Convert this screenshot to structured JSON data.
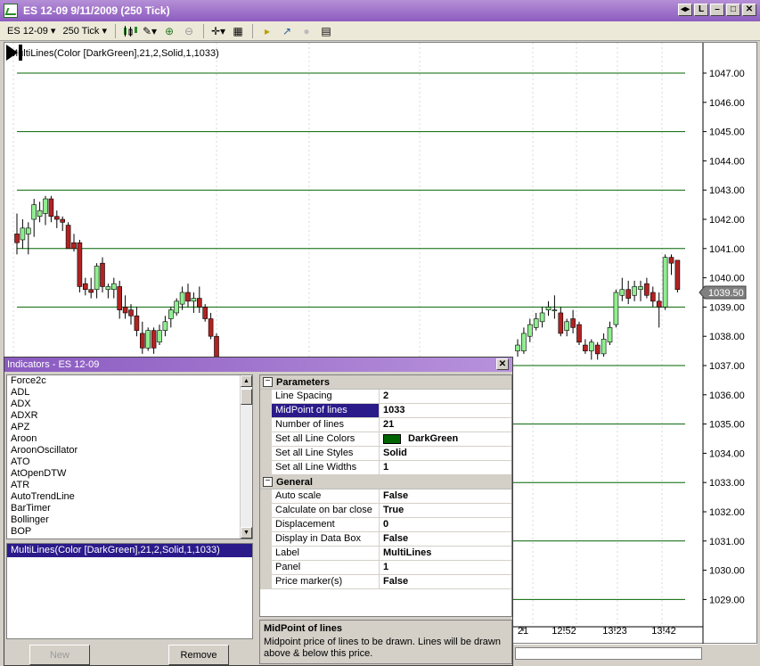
{
  "window": {
    "title": "ES 12-09  9/11/2009 (250 Tick)"
  },
  "toolbar": {
    "instrument": "ES 12-09",
    "interval": "250 Tick"
  },
  "chart": {
    "indicator_label": "MultiLines(Color [DarkGreen],21,2,Solid,1,1033)",
    "price_axis": [
      "1047.00",
      "1046.00",
      "1045.00",
      "1044.00",
      "1043.00",
      "1042.00",
      "1041.00",
      "1040.00",
      "1039.00",
      "1038.00",
      "1037.00",
      "1036.00",
      "1035.00",
      "1034.00",
      "1033.00",
      "1032.00",
      "1031.00",
      "1030.00",
      "1029.00"
    ],
    "last_price": "1039.50",
    "time_axis": [
      "21",
      "12:52",
      "13:23",
      "13:42"
    ],
    "line_color": "#006400",
    "up_color": "#90ee90",
    "down_color": "#b22222"
  },
  "chart_data": {
    "type": "line",
    "title": "MultiLines(Color [DarkGreen],21,2,Solid,1,1033)",
    "ylim": [
      1028.5,
      1047.5
    ],
    "horizontal_lines": [
      1047,
      1045,
      1043,
      1041,
      1039,
      1037,
      1035,
      1033,
      1031,
      1029
    ],
    "last_price": 1039.5,
    "x_ticks": [
      "21",
      "12:52",
      "13:23",
      "13:42"
    ],
    "candles_left": [
      {
        "o": 1041.5,
        "h": 1042.2,
        "l": 1040.8,
        "c": 1041.2
      },
      {
        "o": 1041.3,
        "h": 1042.0,
        "l": 1041.0,
        "c": 1041.7
      },
      {
        "o": 1041.5,
        "h": 1041.9,
        "l": 1040.8,
        "c": 1041.7
      },
      {
        "o": 1042.0,
        "h": 1042.7,
        "l": 1041.4,
        "c": 1042.5
      },
      {
        "o": 1042.1,
        "h": 1042.6,
        "l": 1041.9,
        "c": 1042.3
      },
      {
        "o": 1042.2,
        "h": 1042.8,
        "l": 1041.8,
        "c": 1042.7
      },
      {
        "o": 1042.7,
        "h": 1042.8,
        "l": 1041.9,
        "c": 1042.1
      },
      {
        "o": 1042.1,
        "h": 1042.3,
        "l": 1041.7,
        "c": 1042.0
      },
      {
        "o": 1042.0,
        "h": 1042.1,
        "l": 1041.6,
        "c": 1041.9
      },
      {
        "o": 1041.8,
        "h": 1041.9,
        "l": 1041.0,
        "c": 1041.0
      },
      {
        "o": 1041.2,
        "h": 1041.5,
        "l": 1040.9,
        "c": 1041.0
      },
      {
        "o": 1041.2,
        "h": 1041.3,
        "l": 1039.5,
        "c": 1039.7
      },
      {
        "o": 1039.8,
        "h": 1040.0,
        "l": 1039.4,
        "c": 1039.6
      },
      {
        "o": 1039.6,
        "h": 1040.0,
        "l": 1039.3,
        "c": 1039.5
      },
      {
        "o": 1039.6,
        "h": 1040.5,
        "l": 1039.3,
        "c": 1040.4
      },
      {
        "o": 1040.5,
        "h": 1040.7,
        "l": 1039.5,
        "c": 1039.7
      },
      {
        "o": 1039.6,
        "h": 1039.8,
        "l": 1039.3,
        "c": 1039.7
      },
      {
        "o": 1039.6,
        "h": 1040.0,
        "l": 1039.3,
        "c": 1039.8
      },
      {
        "o": 1039.7,
        "h": 1039.9,
        "l": 1038.6,
        "c": 1038.9
      },
      {
        "o": 1039.0,
        "h": 1039.4,
        "l": 1038.6,
        "c": 1038.8
      },
      {
        "o": 1038.9,
        "h": 1039.1,
        "l": 1038.4,
        "c": 1038.7
      },
      {
        "o": 1038.7,
        "h": 1039.0,
        "l": 1038.0,
        "c": 1038.2
      },
      {
        "o": 1038.1,
        "h": 1038.5,
        "l": 1037.4,
        "c": 1037.6
      },
      {
        "o": 1037.6,
        "h": 1038.3,
        "l": 1037.5,
        "c": 1038.2
      },
      {
        "o": 1038.2,
        "h": 1038.3,
        "l": 1037.4,
        "c": 1037.6
      },
      {
        "o": 1037.8,
        "h": 1038.4,
        "l": 1037.7,
        "c": 1038.2
      },
      {
        "o": 1038.2,
        "h": 1038.7,
        "l": 1038.0,
        "c": 1038.5
      },
      {
        "o": 1038.6,
        "h": 1039.0,
        "l": 1038.3,
        "c": 1038.9
      },
      {
        "o": 1038.8,
        "h": 1039.3,
        "l": 1038.7,
        "c": 1039.2
      },
      {
        "o": 1039.1,
        "h": 1039.7,
        "l": 1038.9,
        "c": 1039.5
      },
      {
        "o": 1039.5,
        "h": 1039.8,
        "l": 1039.0,
        "c": 1039.2
      },
      {
        "o": 1039.2,
        "h": 1039.5,
        "l": 1038.8,
        "c": 1039.3
      },
      {
        "o": 1039.3,
        "h": 1039.7,
        "l": 1038.8,
        "c": 1039.0
      },
      {
        "o": 1039.0,
        "h": 1039.1,
        "l": 1038.5,
        "c": 1038.6
      },
      {
        "o": 1038.6,
        "h": 1038.8,
        "l": 1037.9,
        "c": 1038.0
      },
      {
        "o": 1038.0,
        "h": 1038.1,
        "l": 1037.2,
        "c": 1037.3
      }
    ],
    "candles_right": [
      {
        "o": 1037.5,
        "h": 1037.9,
        "l": 1037.3,
        "c": 1037.7
      },
      {
        "o": 1037.5,
        "h": 1038.3,
        "l": 1037.4,
        "c": 1038.1
      },
      {
        "o": 1038.0,
        "h": 1038.6,
        "l": 1037.8,
        "c": 1038.4
      },
      {
        "o": 1038.3,
        "h": 1038.8,
        "l": 1038.2,
        "c": 1038.6
      },
      {
        "o": 1038.5,
        "h": 1039.0,
        "l": 1038.3,
        "c": 1038.8
      },
      {
        "o": 1038.9,
        "h": 1039.2,
        "l": 1038.7,
        "c": 1039.0
      },
      {
        "o": 1038.9,
        "h": 1039.4,
        "l": 1038.6,
        "c": 1038.9
      },
      {
        "o": 1038.8,
        "h": 1039.0,
        "l": 1038.0,
        "c": 1038.1
      },
      {
        "o": 1038.2,
        "h": 1038.6,
        "l": 1038.0,
        "c": 1038.5
      },
      {
        "o": 1038.6,
        "h": 1038.9,
        "l": 1038.1,
        "c": 1038.3
      },
      {
        "o": 1038.4,
        "h": 1038.5,
        "l": 1037.7,
        "c": 1037.8
      },
      {
        "o": 1037.7,
        "h": 1037.9,
        "l": 1037.4,
        "c": 1037.5
      },
      {
        "o": 1037.5,
        "h": 1037.9,
        "l": 1037.2,
        "c": 1037.8
      },
      {
        "o": 1037.7,
        "h": 1037.8,
        "l": 1037.2,
        "c": 1037.4
      },
      {
        "o": 1037.4,
        "h": 1038.1,
        "l": 1037.3,
        "c": 1037.9
      },
      {
        "o": 1037.8,
        "h": 1038.5,
        "l": 1037.7,
        "c": 1038.3
      },
      {
        "o": 1038.4,
        "h": 1039.6,
        "l": 1038.3,
        "c": 1039.5
      },
      {
        "o": 1039.4,
        "h": 1040.0,
        "l": 1039.2,
        "c": 1039.6
      },
      {
        "o": 1039.6,
        "h": 1039.9,
        "l": 1039.1,
        "c": 1039.3
      },
      {
        "o": 1039.4,
        "h": 1039.9,
        "l": 1039.2,
        "c": 1039.7
      },
      {
        "o": 1039.6,
        "h": 1039.9,
        "l": 1039.2,
        "c": 1039.7
      },
      {
        "o": 1039.8,
        "h": 1040.0,
        "l": 1039.3,
        "c": 1039.4
      },
      {
        "o": 1039.5,
        "h": 1039.7,
        "l": 1039.0,
        "c": 1039.2
      },
      {
        "o": 1039.2,
        "h": 1039.5,
        "l": 1038.3,
        "c": 1039.0
      },
      {
        "o": 1039.0,
        "h": 1040.8,
        "l": 1038.9,
        "c": 1040.7
      },
      {
        "o": 1040.7,
        "h": 1040.8,
        "l": 1040.1,
        "c": 1040.5
      },
      {
        "o": 1040.6,
        "h": 1040.6,
        "l": 1039.5,
        "c": 1039.6
      }
    ]
  },
  "dialog": {
    "title": "Indicators - ES 12-09",
    "indicators": [
      "Force2c",
      "ADL",
      "ADX",
      "ADXR",
      "APZ",
      "Aroon",
      "AroonOscillator",
      "ATO",
      "AtOpenDTW",
      "ATR",
      "AutoTrendLine",
      "BarTimer",
      "Bollinger",
      "BOP"
    ],
    "applied": [
      "MultiLines(Color [DarkGreen],21,2,Solid,1,1033)"
    ],
    "buttons": {
      "new": "New",
      "remove": "Remove"
    },
    "categories": {
      "parameters": "Parameters",
      "general": "General"
    },
    "parameters": [
      {
        "name": "Line Spacing",
        "value": "2"
      },
      {
        "name": "MidPoint of lines",
        "value": "1033"
      },
      {
        "name": "Number of lines",
        "value": "21"
      },
      {
        "name": "Set all Line Colors",
        "value": "DarkGreen"
      },
      {
        "name": "Set all Line Styles",
        "value": "Solid"
      },
      {
        "name": "Set all Line Widths",
        "value": "1"
      }
    ],
    "general": [
      {
        "name": "Auto scale",
        "value": "False"
      },
      {
        "name": "Calculate on bar close",
        "value": "True"
      },
      {
        "name": "Displacement",
        "value": "0"
      },
      {
        "name": "Display in Data Box",
        "value": "False"
      },
      {
        "name": "Label",
        "value": "MultiLines"
      },
      {
        "name": "Panel",
        "value": "1"
      },
      {
        "name": "Price marker(s)",
        "value": "False"
      }
    ],
    "help": {
      "title": "MidPoint of lines",
      "text": "Midpoint price of lines to be drawn. Lines will be drawn above & below this price."
    }
  }
}
